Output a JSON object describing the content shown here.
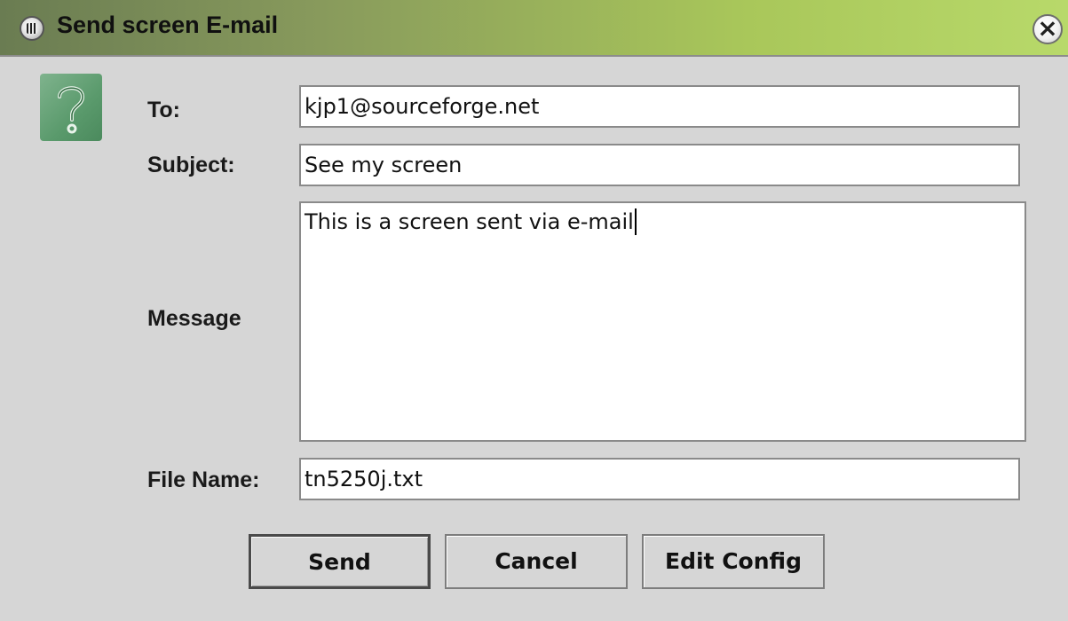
{
  "window": {
    "title": "Send screen E-mail"
  },
  "form": {
    "to_label": "To:",
    "to_value": "kjp1@sourceforge.net",
    "subject_label": "Subject:",
    "subject_value": "See my screen",
    "message_label": "Message",
    "message_value": "This is a screen sent via e-mail",
    "filename_label": "File Name:",
    "filename_value": "tn5250j.txt"
  },
  "buttons": {
    "send": "Send",
    "cancel": "Cancel",
    "edit_config": "Edit Config"
  },
  "icons": {
    "window_icon": "window-menu-icon",
    "close_icon": "close-icon",
    "dialog_icon": "question-icon"
  },
  "colors": {
    "titlebar_accent": "#a9c75a",
    "dialog_background": "#d6d6d6",
    "question_icon_bg": "#5a9a6c"
  }
}
